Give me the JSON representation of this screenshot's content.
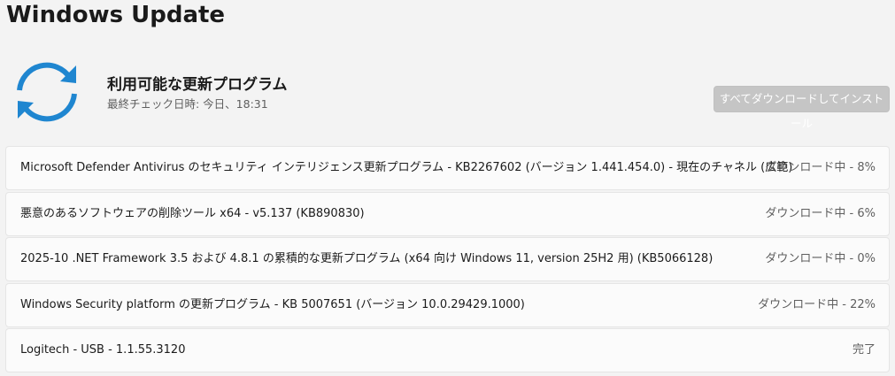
{
  "page": {
    "title": "Windows Update"
  },
  "status": {
    "icon": "sync-arrows-icon",
    "title": "利用可能な更新プログラム",
    "last_checked": "最終チェック日時: 今日、18:31",
    "install_all_label": "すべてダウンロードしてインストール"
  },
  "colors": {
    "accent": "#1f86d0",
    "disabled_button": "#c5c5c5",
    "background": "#f3f3f3",
    "card": "#fbfbfb"
  },
  "updates": [
    {
      "name": "Microsoft Defender Antivirus のセキュリティ インテリジェンス更新プログラム - KB2267602 (バージョン 1.441.454.0) - 現在のチャネル (広範)",
      "status": "ダウンロード中 - 8%"
    },
    {
      "name": "悪意のあるソフトウェアの削除ツール x64 - v5.137 (KB890830)",
      "status": "ダウンロード中 - 6%"
    },
    {
      "name": "2025-10 .NET Framework 3.5 および 4.8.1 の累積的な更新プログラム (x64 向け Windows 11, version 25H2 用) (KB5066128)",
      "status": "ダウンロード中 - 0%"
    },
    {
      "name": "Windows Security platform の更新プログラム - KB 5007651 (バージョン 10.0.29429.1000)",
      "status": "ダウンロード中 - 22%"
    },
    {
      "name": "Logitech - USB - 1.1.55.3120",
      "status": "完了"
    }
  ]
}
